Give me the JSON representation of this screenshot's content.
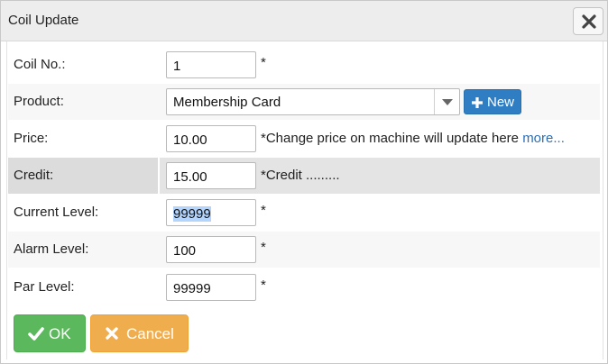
{
  "dialog": {
    "title": "Coil Update",
    "close_icon": "close-icon"
  },
  "fields": {
    "coil_no": {
      "label": "Coil No.:",
      "value": "1",
      "required": "*"
    },
    "product": {
      "label": "Product:",
      "value": "Membership Card",
      "new_label": "New"
    },
    "price": {
      "label": "Price:",
      "value": "10.00",
      "note": "*Change price on machine will update here ",
      "more_link": "more..."
    },
    "credit": {
      "label": "Credit:",
      "value": "15.00",
      "note": "*Credit ........."
    },
    "current_level": {
      "label": "Current Level:",
      "value": "99999",
      "required": "*"
    },
    "alarm_level": {
      "label": "Alarm Level:",
      "value": "100",
      "required": "*"
    },
    "par_level": {
      "label": "Par Level:",
      "value": "99999",
      "required": "*"
    }
  },
  "buttons": {
    "ok_label": "OK",
    "cancel_label": "Cancel"
  },
  "colors": {
    "primary": "#2f7ec4",
    "success": "#5cb85c",
    "warning": "#f0ad4e"
  }
}
